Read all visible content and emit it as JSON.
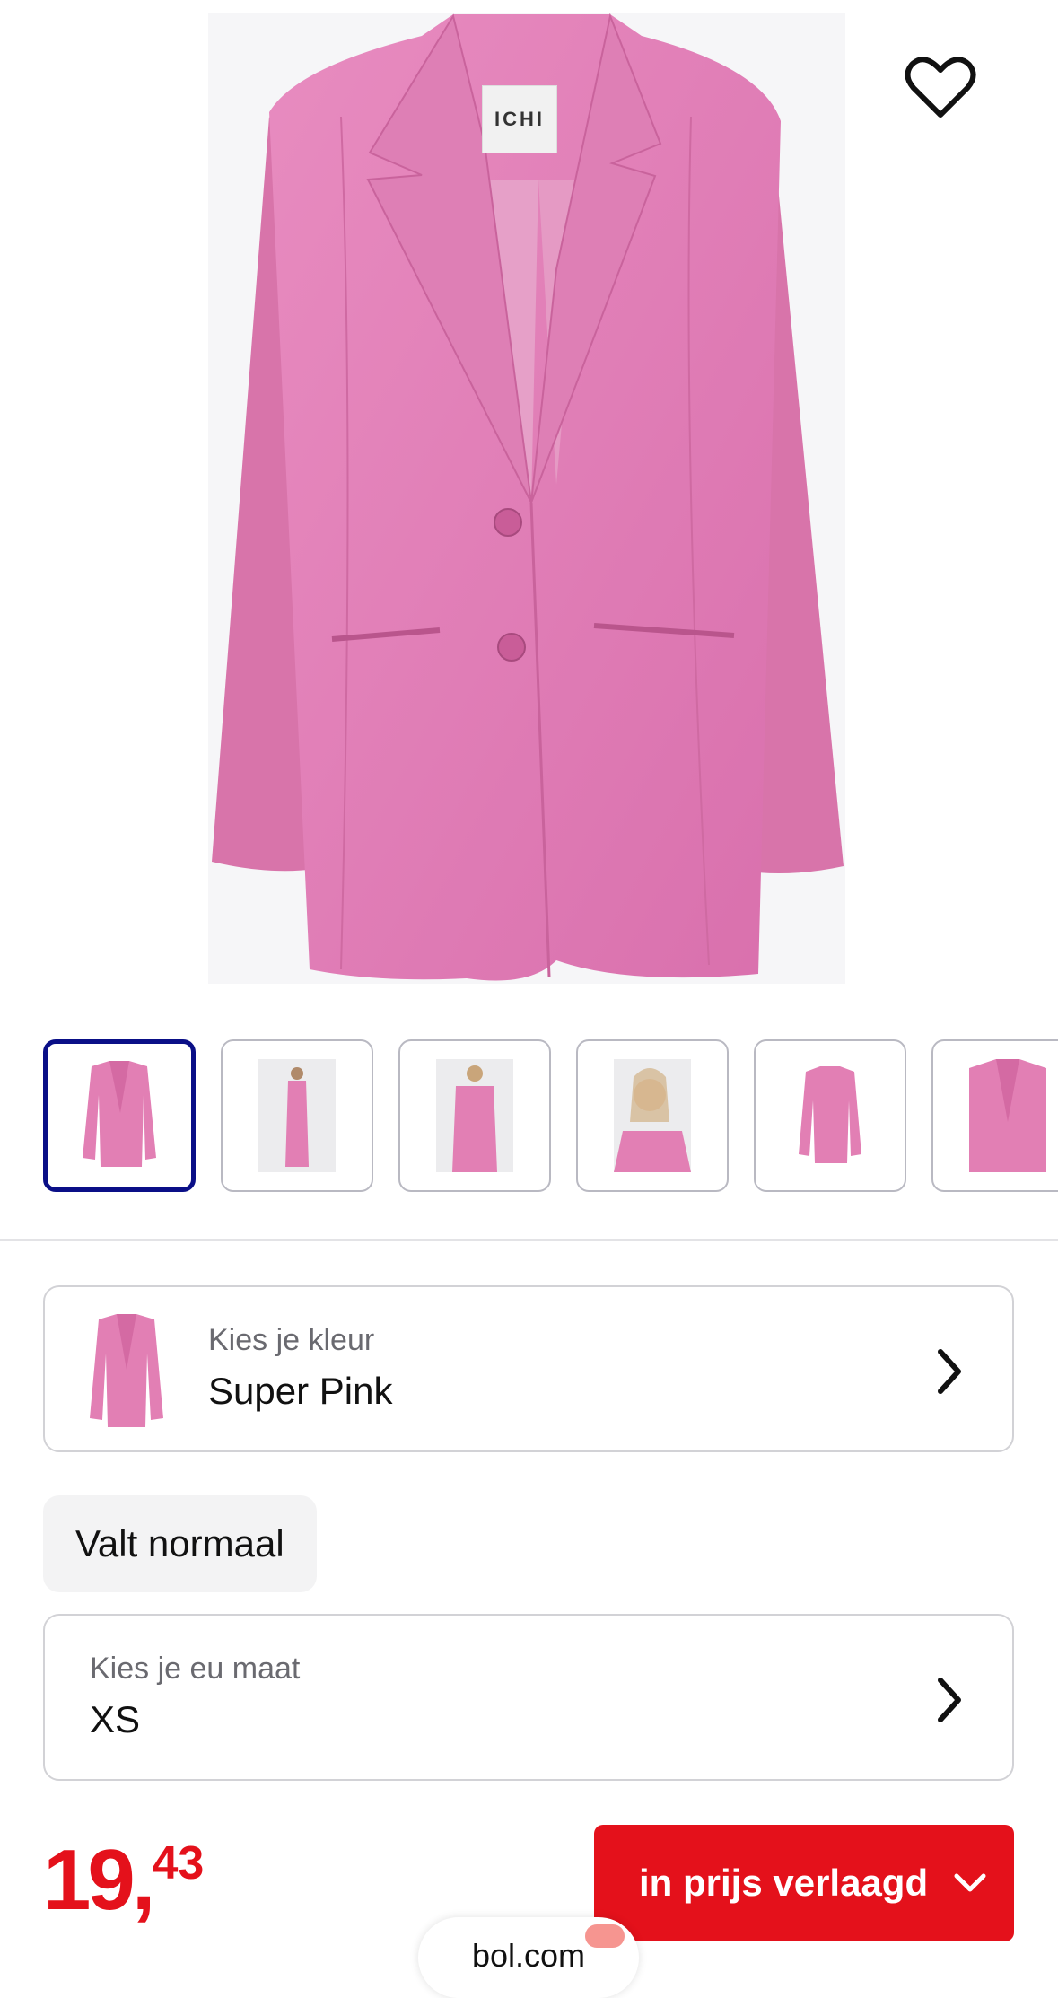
{
  "product_image": {
    "brand_tag": "ICHI",
    "color": "#e27fb4"
  },
  "favorite": {
    "icon": "heart-outline-icon"
  },
  "thumbnails": [
    {
      "kind": "blazer-front",
      "selected": true
    },
    {
      "kind": "model-full"
    },
    {
      "kind": "model-back"
    },
    {
      "kind": "model-portrait"
    },
    {
      "kind": "blazer-front-small"
    },
    {
      "kind": "blazer-front-crop"
    }
  ],
  "color_selector": {
    "label": "Kies je kleur",
    "value": "Super Pink"
  },
  "fit_chip": "Valt normaal",
  "size_selector": {
    "label": "Kies je eu maat",
    "value": "XS"
  },
  "price": {
    "euros": "19",
    "separator": ",",
    "cents": "43"
  },
  "cta": {
    "label": "in prijs verlaagd"
  },
  "browser": {
    "url": "bol.com"
  },
  "colors": {
    "accent_red": "#e4111b",
    "selected_border": "#0a0f87",
    "pink": "#e27fb4"
  }
}
